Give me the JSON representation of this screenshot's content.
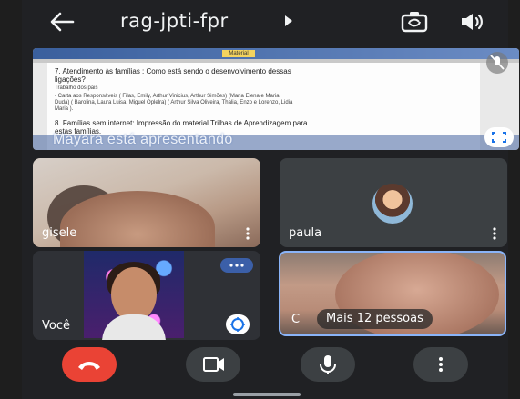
{
  "header": {
    "back_icon": "arrow-left-icon",
    "meeting_code": "rag-jpti-fpr",
    "caret_icon": "triangle-right-icon",
    "switch_camera_icon": "camera-switch-icon",
    "audio_icon": "speaker-icon"
  },
  "presentation": {
    "doc_tab": "Material",
    "lines": [
      "7. Atendimento às famílias : Como está sendo o desenvolvimento dessas",
      "ligações?",
      "Trabalho dos pais",
      "- Carta aos Responsáveis ( Filas, Emily, Arthur Vinicius, Arthur Simões) (Maria Elena e Maria",
      "Duda) ( Barolina, Laura Luisa, Miguel Oplelra) ( Arthur Silva Oliveira, Thalia, Enzo e Lorenzo, Lidia",
      "Maria ).",
      "8. Famílias sem internet: Impressão do material Trilhas de Aprendizagem para",
      "estas famílias."
    ],
    "presenting_text": "Mayara está apresentando",
    "fullscreen_icon": "fullscreen-icon",
    "mute_icon": "mic-off-icon"
  },
  "participants": {
    "gisele": {
      "name": "gisele"
    },
    "paula": {
      "name": "paula"
    },
    "voce": {
      "name": "Você"
    },
    "group": {
      "label": "Mais 12 pessoas",
      "initial": "C"
    }
  },
  "controls": {
    "end_call_icon": "phone-hangup-icon",
    "video_icon": "video-camera-icon",
    "mic_icon": "microphone-icon",
    "more_icon": "more-vertical-icon"
  },
  "colors": {
    "end_call": "#ea4335",
    "active_speaker_border": "#8ab4f8",
    "control_bg": "#3c4043"
  }
}
